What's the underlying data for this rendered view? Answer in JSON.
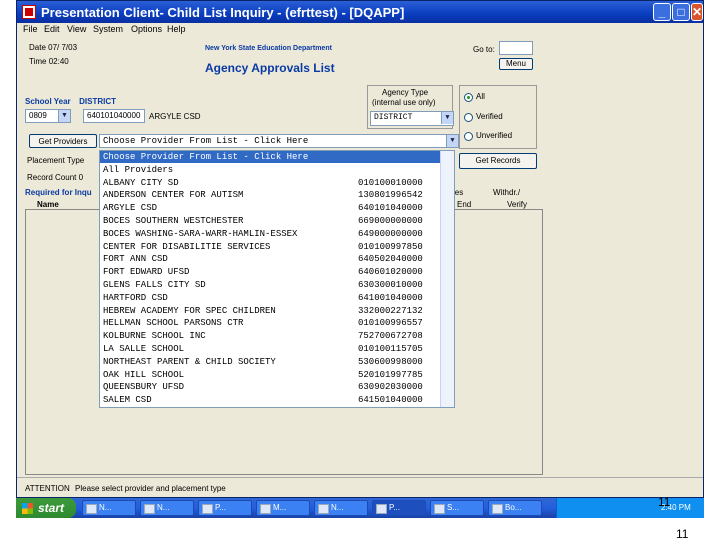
{
  "window": {
    "title": "Presentation Client- Child List Inquiry - (efrttest) - [DQAPP]",
    "menu": [
      "File",
      "Edit",
      "View",
      "System",
      "Options",
      "Help"
    ]
  },
  "header": {
    "date": "Date 07/ 7/03",
    "time": "Time 02:40",
    "dept": "New York State Education Department",
    "title": "Agency Approvals List",
    "goto_label": "Go to:",
    "menu_button": "Menu"
  },
  "filters": {
    "school_year_label": "School Year",
    "district_label": "DISTRICT",
    "school_year_value": "0809",
    "district_code": "640101040000",
    "district_name": "ARGYLE CSD",
    "agency_type_label": "Agency Type",
    "agency_type_note": "(internal use only)",
    "agency_type_value": "DISTRICT",
    "radio_all": "All",
    "radio_verified": "Verified",
    "radio_unverified": "Unverified",
    "get_providers": "Get Providers",
    "get_records": "Get Records",
    "placement_type": "Placement Type",
    "record_count": "Record Count 0",
    "required_label": "Required for Inqu",
    "name_col": "Name",
    "ies_col": "ies",
    "end_col": "End",
    "withdr_col": "Withdr./",
    "verify_col": "Verify"
  },
  "provider_select": {
    "selected": "Choose Provider From List - Click Here",
    "options": [
      {
        "name": "Choose Provider From List - Click Here",
        "code": ""
      },
      {
        "name": "All Providers",
        "code": ""
      },
      {
        "name": "ALBANY CITY SD",
        "code": "010100010000"
      },
      {
        "name": "ANDERSON CENTER FOR AUTISM",
        "code": "130801996542"
      },
      {
        "name": "ARGYLE CSD",
        "code": "640101040000"
      },
      {
        "name": "BOCES SOUTHERN WESTCHESTER",
        "code": "669000000000"
      },
      {
        "name": "BOCES WASHING-SARA-WARR-HAMLIN-ESSEX",
        "code": "649000000000"
      },
      {
        "name": "CENTER FOR DISABILITIE SERVICES",
        "code": "010100997850"
      },
      {
        "name": "FORT ANN CSD",
        "code": "640502040000"
      },
      {
        "name": "FORT EDWARD UFSD",
        "code": "640601020000"
      },
      {
        "name": "GLENS FALLS CITY SD",
        "code": "630300010000"
      },
      {
        "name": "HARTFORD CSD",
        "code": "641001040000"
      },
      {
        "name": "HEBREW ACADEMY FOR SPEC CHILDREN",
        "code": "332000227132"
      },
      {
        "name": "HELLMAN SCHOOL PARSONS CTR",
        "code": "010100996557"
      },
      {
        "name": "KOLBURNE SCHOOL INC",
        "code": "752700672708"
      },
      {
        "name": "LA SALLE SCHOOL",
        "code": "010100115705"
      },
      {
        "name": "NORTHEAST PARENT & CHILD SOCIETY",
        "code": "530600998000"
      },
      {
        "name": "OAK HILL SCHOOL",
        "code": "520101997785"
      },
      {
        "name": "QUEENSBURY UFSD",
        "code": "630902030000"
      },
      {
        "name": "SALEM CSD",
        "code": "641501040000"
      }
    ]
  },
  "status": {
    "attention": "ATTENTION",
    "message": "Please select provider and placement type"
  },
  "taskbar": {
    "start": "start",
    "tasks": [
      "N...",
      "N...",
      "P...",
      "M...",
      "N...",
      "P...",
      "S...",
      "Bo..."
    ],
    "clock": "2:40 PM"
  },
  "slide_number": "11",
  "ghost_number": "11"
}
